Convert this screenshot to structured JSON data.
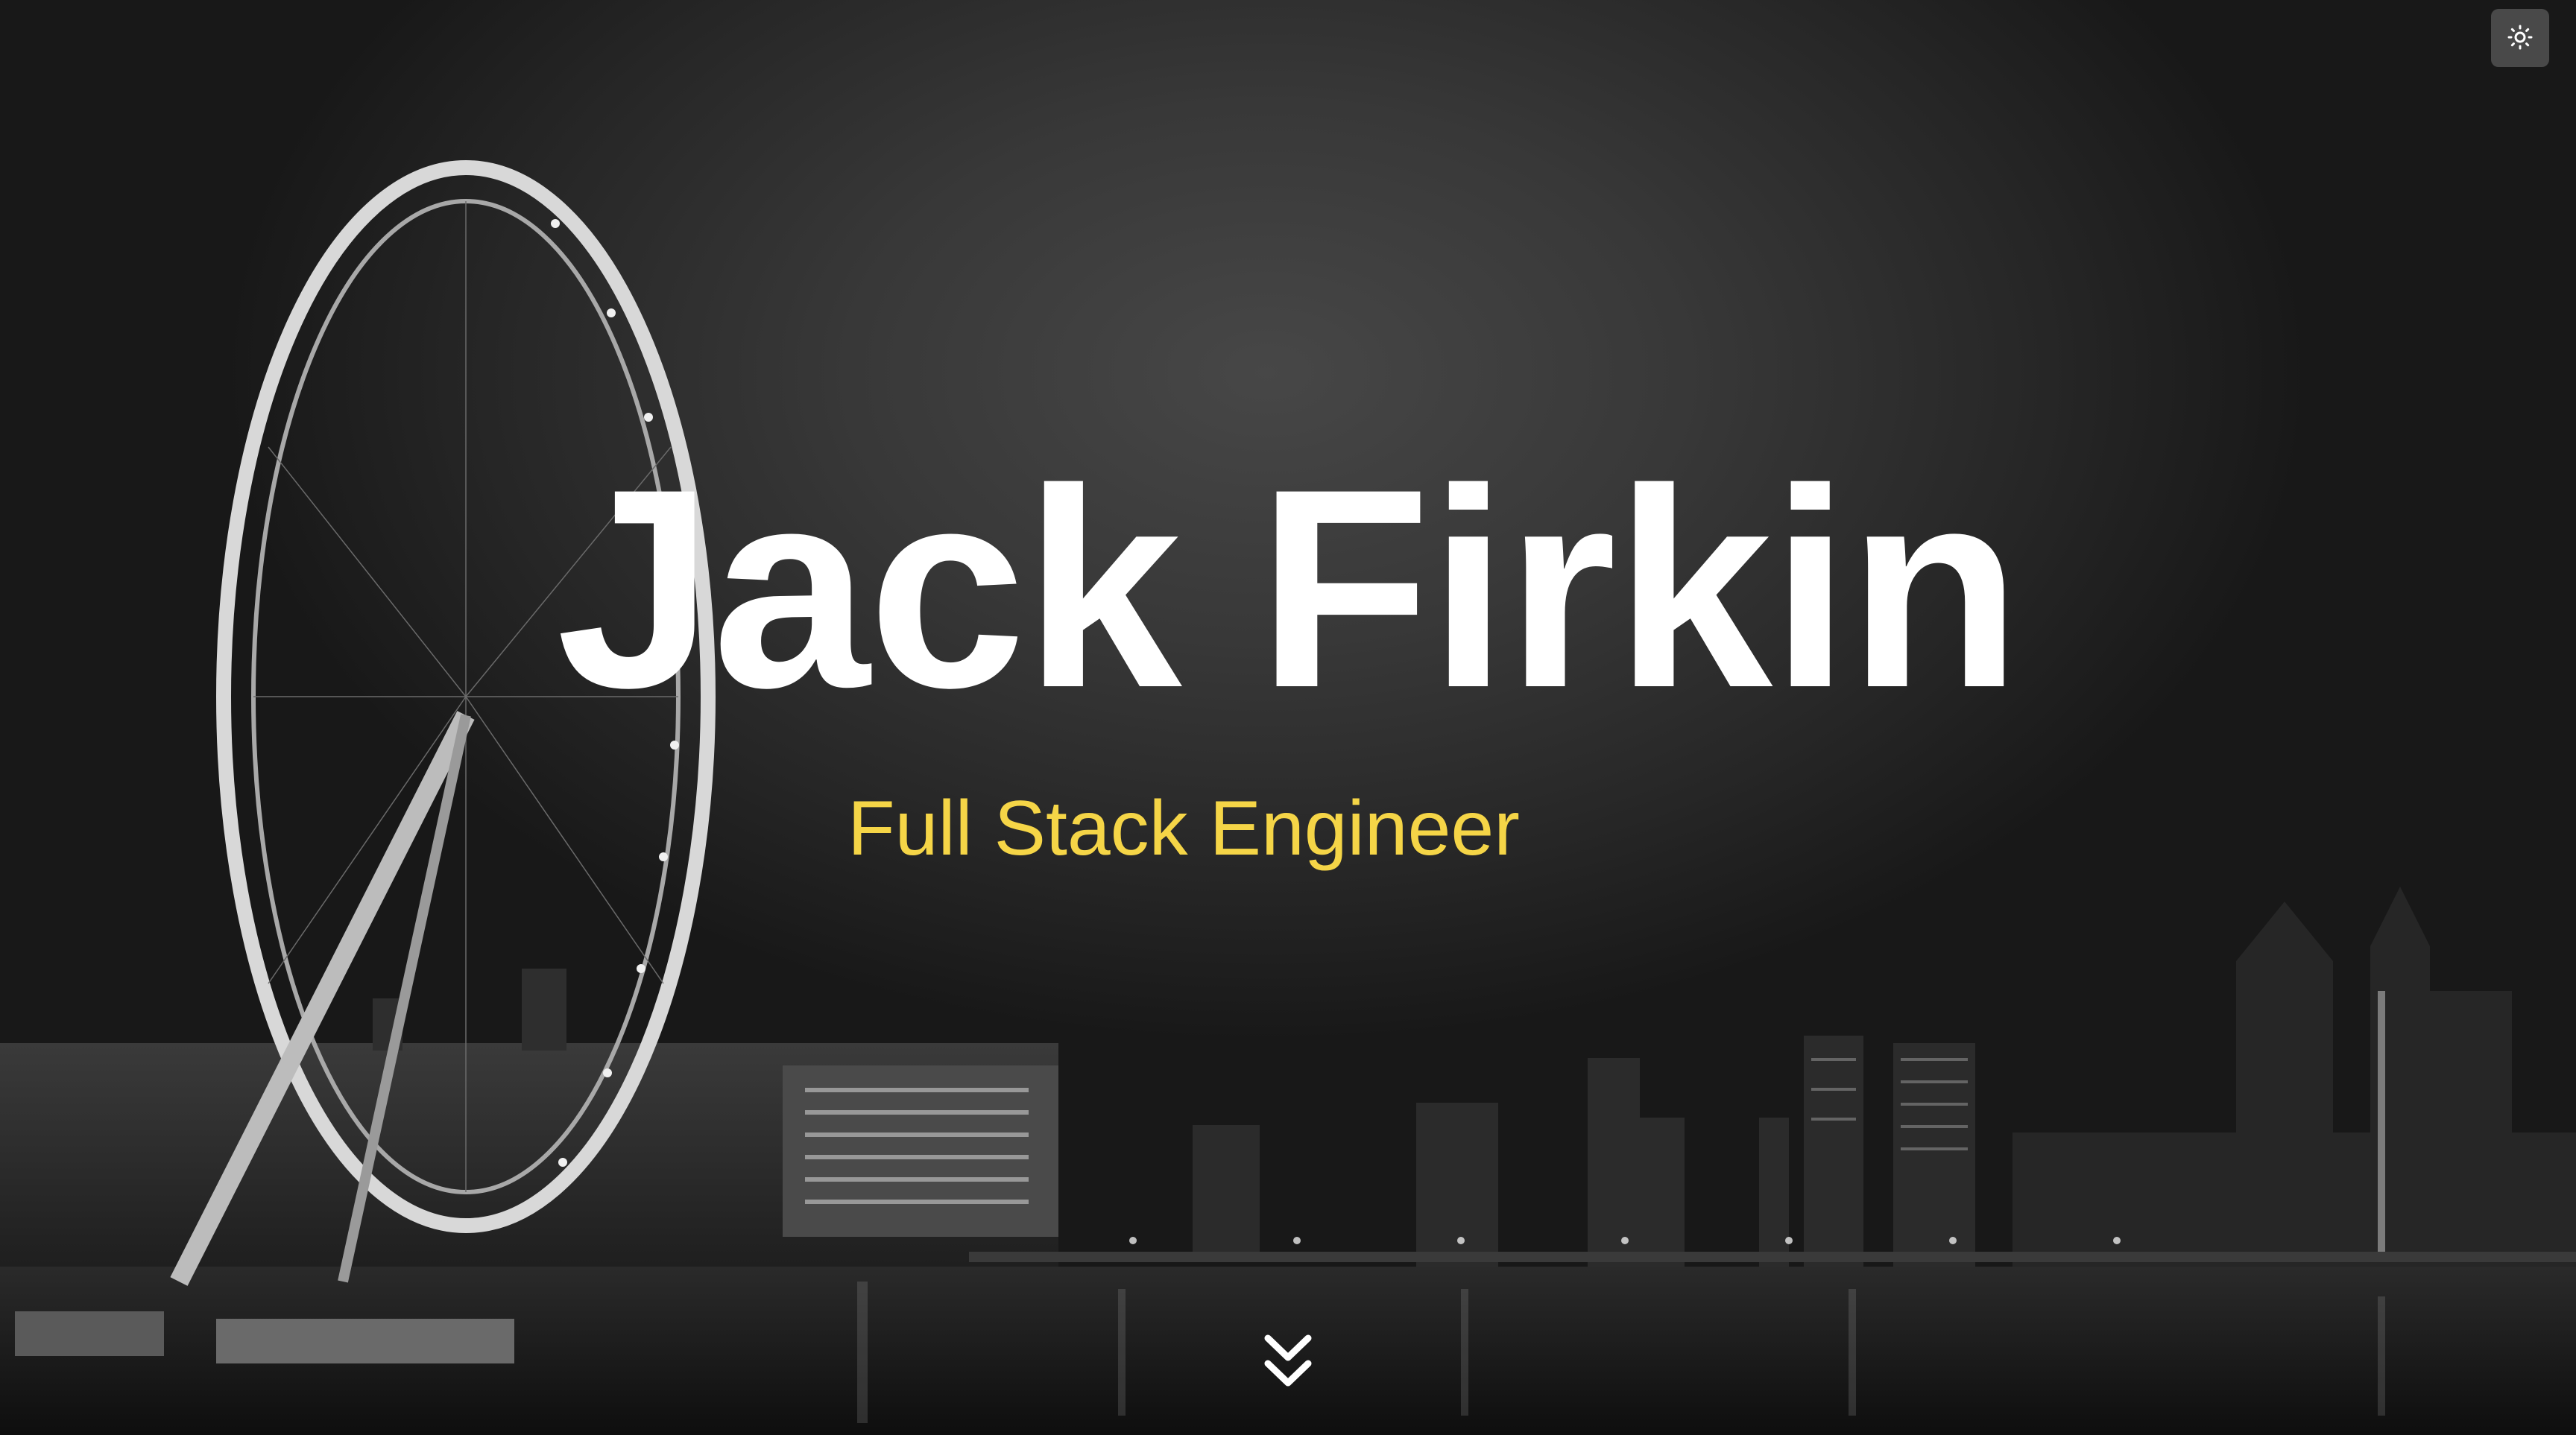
{
  "hero": {
    "name": "Jack Firkin",
    "role": "Full Stack Engineer"
  },
  "controls": {
    "theme_toggle_icon": "sun-icon",
    "scroll_icon": "double-chevron-down-icon"
  },
  "colors": {
    "name": "#ffffff",
    "role": "#f5d547",
    "background": "#262626"
  }
}
